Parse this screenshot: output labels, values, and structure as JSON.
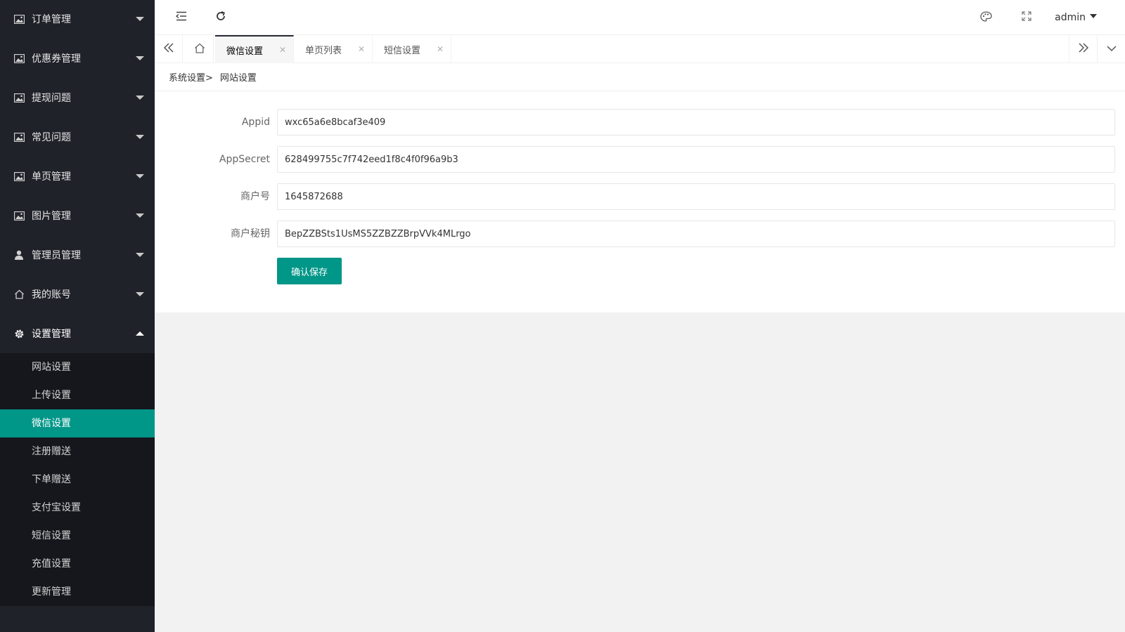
{
  "sidebar": {
    "menus": [
      {
        "label": "订单管理",
        "icon": "image-icon"
      },
      {
        "label": "优惠券管理",
        "icon": "image-icon"
      },
      {
        "label": "提现问题",
        "icon": "image-icon"
      },
      {
        "label": "常见问题",
        "icon": "image-icon"
      },
      {
        "label": "单页管理",
        "icon": "image-icon"
      },
      {
        "label": "图片管理",
        "icon": "image-icon"
      },
      {
        "label": "管理员管理",
        "icon": "user-icon"
      },
      {
        "label": "我的账号",
        "icon": "home-icon"
      },
      {
        "label": "设置管理",
        "icon": "gear-icon"
      }
    ],
    "submenu": [
      {
        "label": "网站设置"
      },
      {
        "label": "上传设置"
      },
      {
        "label": "微信设置"
      },
      {
        "label": "注册赠送"
      },
      {
        "label": "下单赠送"
      },
      {
        "label": "支付宝设置"
      },
      {
        "label": "短信设置"
      },
      {
        "label": "充值设置"
      },
      {
        "label": "更新管理"
      }
    ],
    "active_submenu": "微信设置"
  },
  "header": {
    "user": "admin"
  },
  "tabs": [
    {
      "label": "微信设置",
      "active": true
    },
    {
      "label": "单页列表",
      "active": false
    },
    {
      "label": "短信设置",
      "active": false
    }
  ],
  "breadcrumb": {
    "parent": "系统设置>",
    "current": "网站设置"
  },
  "form": {
    "fields": [
      {
        "label": "Appid",
        "value": "wxc65a6e8bcaf3e409"
      },
      {
        "label": "AppSecret",
        "value": "628499755c7f742eed1f8c4f0f96a9b3"
      },
      {
        "label": "商户号",
        "value": "1645872688"
      },
      {
        "label": "商户秘钥",
        "value": "BepZZBSts1UsMS5ZZBZZBrpVVk4MLrgo"
      }
    ],
    "submit_label": "确认保存"
  },
  "colors": {
    "accent": "#009688",
    "sidebar_bg": "#20222a",
    "submenu_bg": "#15171d"
  }
}
